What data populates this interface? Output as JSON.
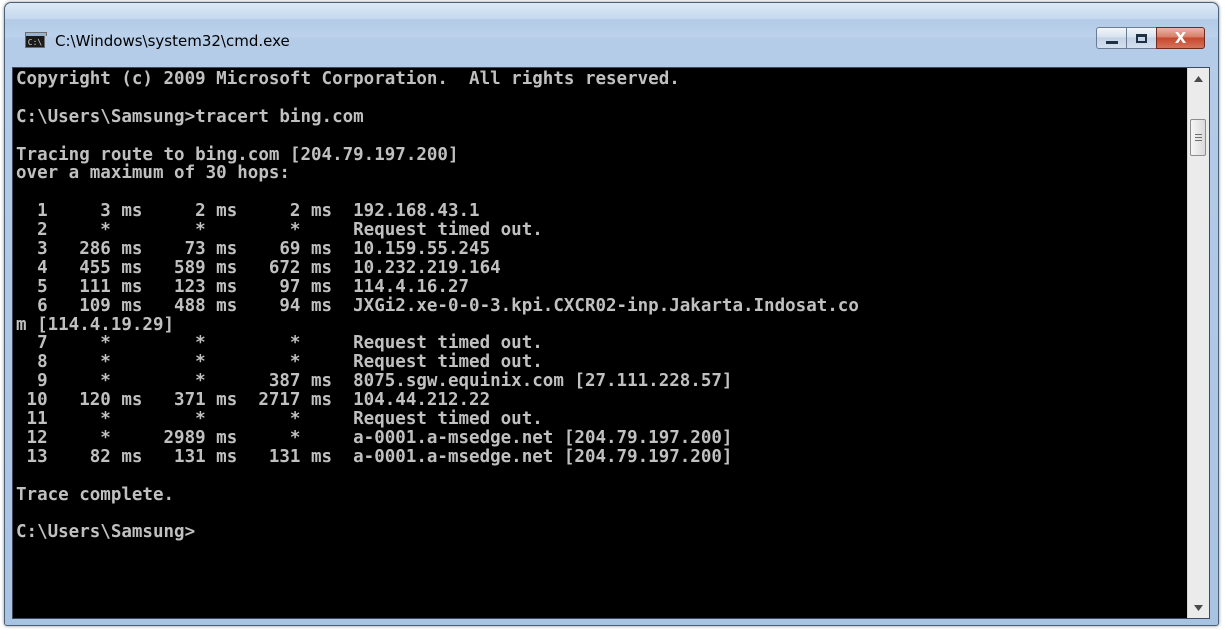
{
  "window": {
    "title": "C:\\Windows\\system32\\cmd.exe",
    "icon": "console-app-icon",
    "icon_label": "C:\\",
    "caption_buttons": {
      "minimize": "minimize-icon",
      "maximize": "maximize-icon",
      "close_label": "X"
    }
  },
  "console": {
    "lines": [
      "Copyright (c) 2009 Microsoft Corporation.  All rights reserved.",
      "",
      "C:\\Users\\Samsung>tracert bing.com",
      "",
      "Tracing route to bing.com [204.79.197.200]",
      "over a maximum of 30 hops:",
      "",
      "  1     3 ms     2 ms     2 ms  192.168.43.1",
      "  2     *        *        *     Request timed out.",
      "  3   286 ms    73 ms    69 ms  10.159.55.245",
      "  4   455 ms   589 ms   672 ms  10.232.219.164",
      "  5   111 ms   123 ms    97 ms  114.4.16.27",
      "  6   109 ms   488 ms    94 ms  JXGi2.xe-0-0-3.kpi.CXCR02-inp.Jakarta.Indosat.co",
      "m [114.4.19.29]",
      "  7     *        *        *     Request timed out.",
      "  8     *        *        *     Request timed out.",
      "  9     *        *      387 ms  8075.sgw.equinix.com [27.111.228.57]",
      " 10   120 ms   371 ms  2717 ms  104.44.212.22",
      " 11     *        *        *     Request timed out.",
      " 12     *     2989 ms     *     a-0001.a-msedge.net [204.79.197.200]",
      " 13    82 ms   131 ms   131 ms  a-0001.a-msedge.net [204.79.197.200]",
      "",
      "Trace complete.",
      "",
      "C:\\Users\\Samsung>"
    ],
    "colors": {
      "background": "#000000",
      "text": "#c0c0c0"
    }
  },
  "scrollbar": {
    "up_arrow": "scroll-up-arrow-icon",
    "down_arrow": "scroll-down-arrow-icon"
  }
}
